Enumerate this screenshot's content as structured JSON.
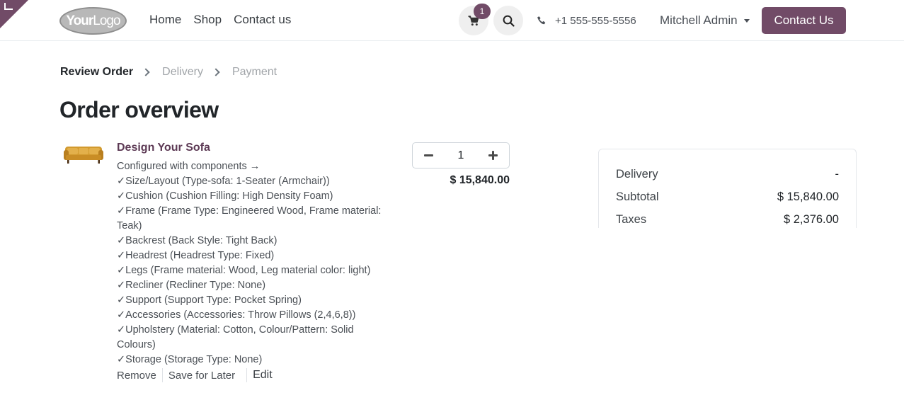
{
  "header": {
    "logo_text_bold": "Your",
    "logo_text_rest": "Logo",
    "nav": [
      {
        "label": "Home"
      },
      {
        "label": "Shop"
      },
      {
        "label": "Contact us"
      }
    ],
    "cart_count": "1",
    "phone": "+1 555-555-5556",
    "user_name": "Mitchell Admin",
    "contact_button": "Contact Us"
  },
  "breadcrumb": {
    "steps": [
      {
        "label": "Review Order",
        "state": "active"
      },
      {
        "label": "Delivery",
        "state": "inactive"
      },
      {
        "label": "Payment",
        "state": "inactive"
      }
    ]
  },
  "page_title": "Order overview",
  "order_line": {
    "product_name": "Design Your Sofa",
    "configured_text": "Configured with components →",
    "components": [
      "✓Size/Layout (Type-sofa: 1-Seater (Armchair))",
      "✓Cushion (Cushion Filling: High Density Foam)",
      "✓Frame (Frame Type: Engineered Wood, Frame material: Teak)",
      "✓Backrest (Back Style: Tight Back)",
      "✓Headrest (Headrest Type: Fixed)",
      "✓Legs (Frame material: Wood, Leg material color: light)",
      "✓Recliner (Recliner Type: None)",
      "✓Support (Support Type: Pocket Spring)",
      "✓Accessories (Accessories: Throw Pillows (2,4,6,8))",
      "✓Upholstery (Material: Cotton, Colour/Pattern: Solid Colours)",
      "✓Storage (Storage Type: None)"
    ],
    "actions": {
      "remove": "Remove",
      "save_for_later": "Save for Later",
      "edit": "Edit"
    },
    "quantity": "1",
    "price": "$ 15,840.00"
  },
  "summary": {
    "rows": [
      {
        "label": "Delivery",
        "value": "-"
      },
      {
        "label": "Subtotal",
        "value": "$ 15,840.00"
      },
      {
        "label": "Taxes",
        "value": "$ 2,376.00"
      }
    ]
  },
  "colors": {
    "brand": "#714b67",
    "product_name": "#5d3a55"
  }
}
